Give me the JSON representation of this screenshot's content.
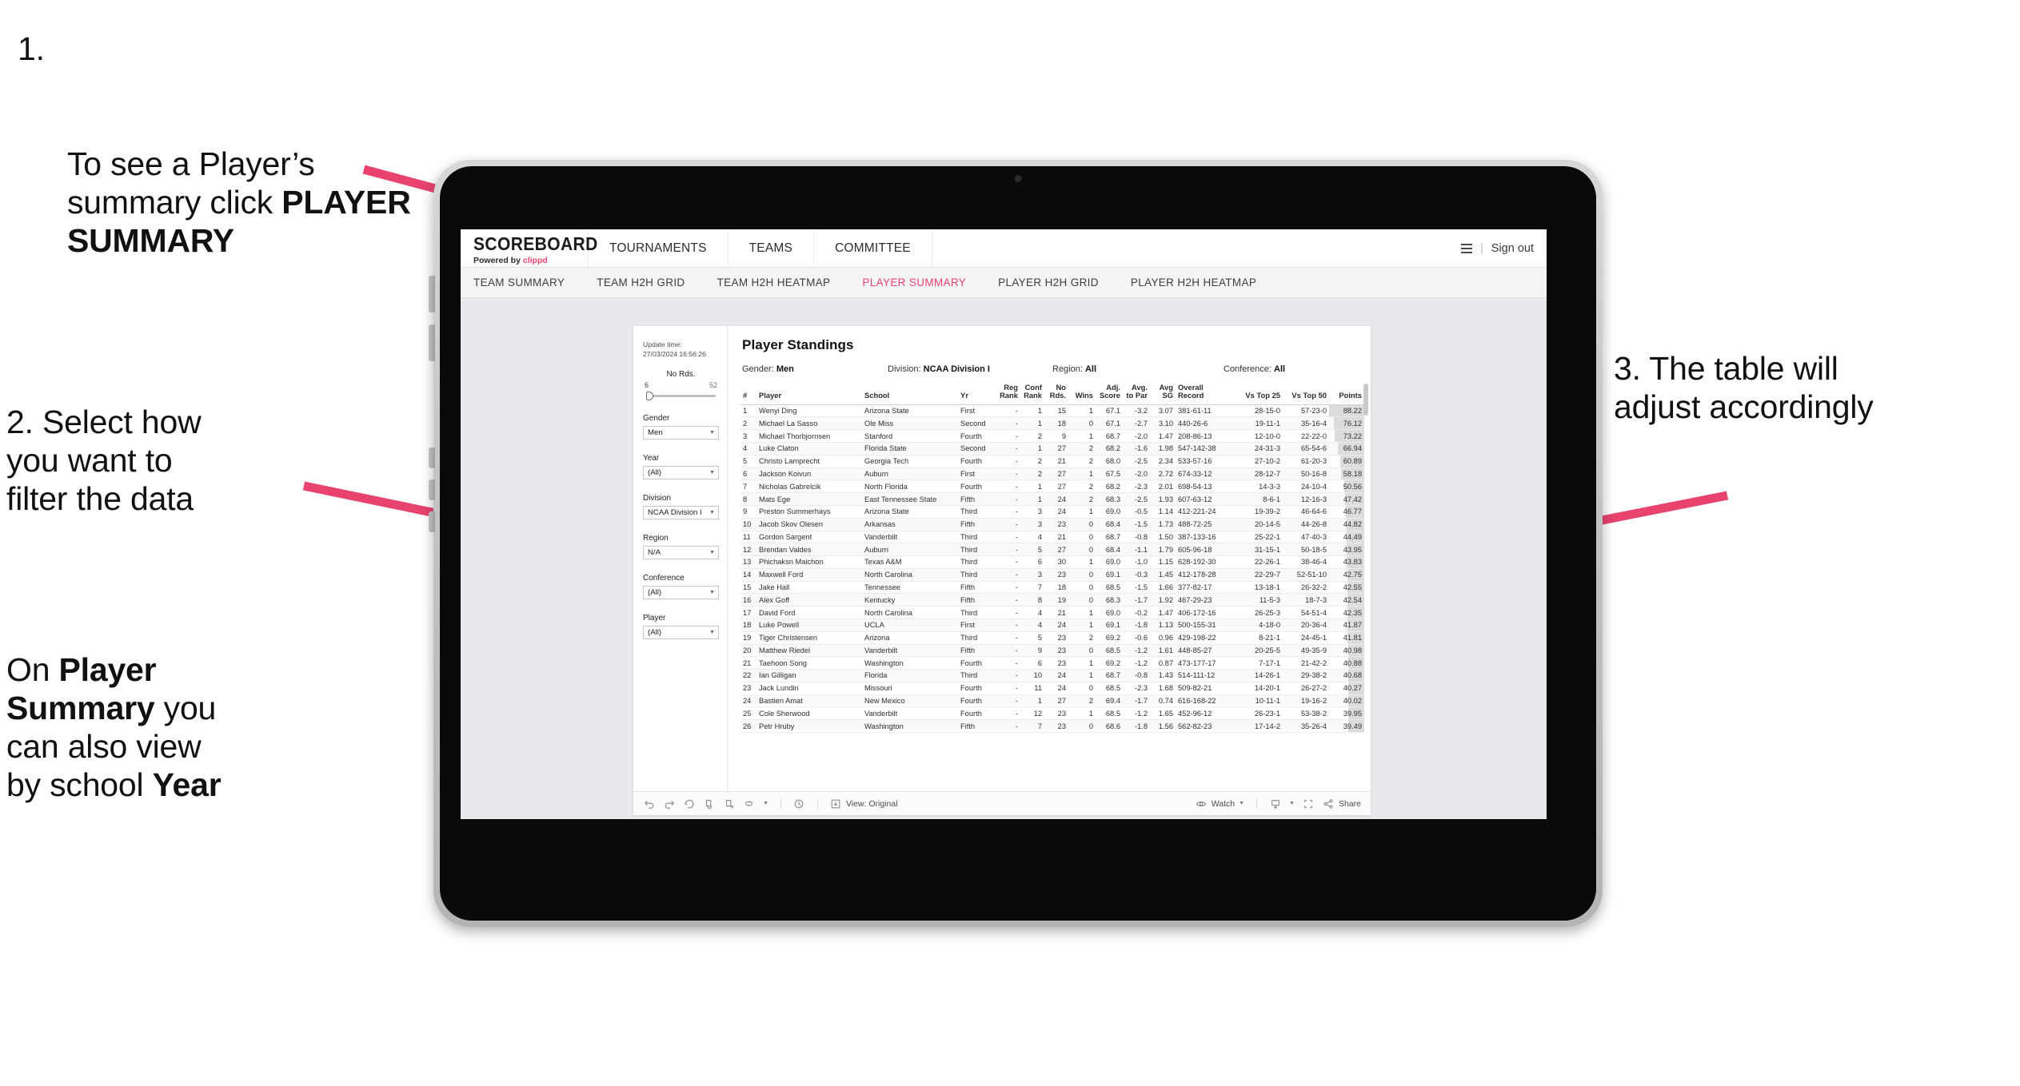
{
  "annotations": {
    "step1": {
      "number": "1.",
      "text_a": "To see a Player’s\nsummary click ",
      "bold_a": "PLAYER\nSUMMARY"
    },
    "step2": {
      "text": "2. Select how\nyou want to\nfilter the data"
    },
    "step3": {
      "pre": "On ",
      "b1": "Player\nSummary",
      "mid": " you\ncan also view\nby school ",
      "b2": "Year"
    },
    "step4": {
      "text": "3. The table will\nadjust accordingly"
    },
    "arrow_color": "#E8436F"
  },
  "app": {
    "brand": {
      "name": "SCOREBOARD",
      "powered_prefix": "Powered by ",
      "powered_brand": "clippd"
    },
    "top_nav": [
      "TOURNAMENTS",
      "TEAMS",
      "COMMITTEE"
    ],
    "top_right": {
      "separator": "|",
      "sign_out": "Sign out"
    },
    "sub_nav": [
      {
        "label": "TEAM SUMMARY",
        "active": false
      },
      {
        "label": "TEAM H2H GRID",
        "active": false
      },
      {
        "label": "TEAM H2H HEATMAP",
        "active": false
      },
      {
        "label": "PLAYER SUMMARY",
        "active": true
      },
      {
        "label": "PLAYER H2H GRID",
        "active": false
      },
      {
        "label": "PLAYER H2H HEATMAP",
        "active": false
      }
    ],
    "active_color": "#E8436F"
  },
  "filters": {
    "update_label": "Update time:",
    "update_value": "27/03/2024 16:56:26",
    "slider": {
      "title": "No Rds.",
      "min": "6",
      "max": "52"
    },
    "selects": [
      {
        "label": "Gender",
        "value": "Men"
      },
      {
        "label": "Year",
        "value": "(All)"
      },
      {
        "label": "Division",
        "value": "NCAA Division I"
      },
      {
        "label": "Region",
        "value": "N/A"
      },
      {
        "label": "Conference",
        "value": "(All)"
      },
      {
        "label": "Player",
        "value": "(All)"
      }
    ]
  },
  "panel": {
    "title": "Player Standings",
    "meta": [
      {
        "label": "Gender:",
        "value": "Men"
      },
      {
        "label": "Division:",
        "value": "NCAA Division I"
      },
      {
        "label": "Region:",
        "value": "All"
      },
      {
        "label": "Conference:",
        "value": "All"
      }
    ]
  },
  "table": {
    "columns": [
      "#",
      "Player",
      "School",
      "Yr",
      "Reg\nRank",
      "Conf\nRank",
      "No\nRds.",
      "Wins",
      "Adj.\nScore",
      "Avg.\nto Par",
      "Avg\nSG",
      "Overall\nRecord",
      "Vs Top 25",
      "Vs Top 50",
      "Points"
    ],
    "rows": [
      [
        "1",
        "Wenyi Ding",
        "Arizona State",
        "First",
        "-",
        "1",
        "15",
        "1",
        "67.1",
        "-3.2",
        "3.07",
        "381-61-11",
        "28-15-0",
        "57-23-0",
        "88.22"
      ],
      [
        "2",
        "Michael La Sasso",
        "Ole Miss",
        "Second",
        "-",
        "1",
        "18",
        "0",
        "67.1",
        "-2.7",
        "3.10",
        "440-26-6",
        "19-11-1",
        "35-16-4",
        "76.12"
      ],
      [
        "3",
        "Michael Thorbjornsen",
        "Stanford",
        "Fourth",
        "-",
        "2",
        "9",
        "1",
        "68.7",
        "-2.0",
        "1.47",
        "208-86-13",
        "12-10-0",
        "22-22-0",
        "73.22"
      ],
      [
        "4",
        "Luke Claton",
        "Florida State",
        "Second",
        "-",
        "1",
        "27",
        "2",
        "68.2",
        "-1.6",
        "1.98",
        "547-142-38",
        "24-31-3",
        "65-54-6",
        "66.94"
      ],
      [
        "5",
        "Christo Lamprecht",
        "Georgia Tech",
        "Fourth",
        "-",
        "2",
        "21",
        "2",
        "68.0",
        "-2.5",
        "2.34",
        "533-57-16",
        "27-10-2",
        "61-20-3",
        "60.89"
      ],
      [
        "6",
        "Jackson Koivun",
        "Auburn",
        "First",
        "-",
        "2",
        "27",
        "1",
        "67.5",
        "-2.0",
        "2.72",
        "674-33-12",
        "28-12-7",
        "50-16-8",
        "58.18"
      ],
      [
        "7",
        "Nicholas Gabrelcik",
        "North Florida",
        "Fourth",
        "-",
        "1",
        "27",
        "2",
        "68.2",
        "-2.3",
        "2.01",
        "698-54-13",
        "14-3-3",
        "24-10-4",
        "50.56"
      ],
      [
        "8",
        "Mats Ege",
        "East Tennessee State",
        "Fifth",
        "-",
        "1",
        "24",
        "2",
        "68.3",
        "-2.5",
        "1.93",
        "607-63-12",
        "8-6-1",
        "12-16-3",
        "47.42"
      ],
      [
        "9",
        "Preston Summerhays",
        "Arizona State",
        "Third",
        "-",
        "3",
        "24",
        "1",
        "69.0",
        "-0.5",
        "1.14",
        "412-221-24",
        "19-39-2",
        "46-64-6",
        "46.77"
      ],
      [
        "10",
        "Jacob Skov Olesen",
        "Arkansas",
        "Fifth",
        "-",
        "3",
        "23",
        "0",
        "68.4",
        "-1.5",
        "1.73",
        "488-72-25",
        "20-14-5",
        "44-26-8",
        "44.82"
      ],
      [
        "11",
        "Gordon Sargent",
        "Vanderbilt",
        "Third",
        "-",
        "4",
        "21",
        "0",
        "68.7",
        "-0.8",
        "1.50",
        "387-133-16",
        "25-22-1",
        "47-40-3",
        "44.49"
      ],
      [
        "12",
        "Brendan Valdes",
        "Auburn",
        "Third",
        "-",
        "5",
        "27",
        "0",
        "68.4",
        "-1.1",
        "1.79",
        "605-96-18",
        "31-15-1",
        "50-18-5",
        "43.95"
      ],
      [
        "13",
        "Phichaksn Maichon",
        "Texas A&M",
        "Third",
        "-",
        "6",
        "30",
        "1",
        "69.0",
        "-1.0",
        "1.15",
        "628-192-30",
        "22-26-1",
        "38-46-4",
        "43.83"
      ],
      [
        "14",
        "Maxwell Ford",
        "North Carolina",
        "Third",
        "-",
        "3",
        "23",
        "0",
        "69.1",
        "-0.3",
        "1.45",
        "412-178-28",
        "22-29-7",
        "52-51-10",
        "42.75"
      ],
      [
        "15",
        "Jake Hall",
        "Tennessee",
        "Fifth",
        "-",
        "7",
        "18",
        "0",
        "68.5",
        "-1.5",
        "1.66",
        "377-82-17",
        "13-18-1",
        "26-32-2",
        "42.55"
      ],
      [
        "16",
        "Alex Goff",
        "Kentucky",
        "Fifth",
        "-",
        "8",
        "19",
        "0",
        "68.3",
        "-1.7",
        "1.92",
        "467-29-23",
        "11-5-3",
        "18-7-3",
        "42.54"
      ],
      [
        "17",
        "David Ford",
        "North Carolina",
        "Third",
        "-",
        "4",
        "21",
        "1",
        "69.0",
        "-0.2",
        "1.47",
        "406-172-16",
        "26-25-3",
        "54-51-4",
        "42.35"
      ],
      [
        "18",
        "Luke Powell",
        "UCLA",
        "First",
        "-",
        "4",
        "24",
        "1",
        "69.1",
        "-1.8",
        "1.13",
        "500-155-31",
        "4-18-0",
        "20-36-4",
        "41.87"
      ],
      [
        "19",
        "Tiger Christensen",
        "Arizona",
        "Third",
        "-",
        "5",
        "23",
        "2",
        "69.2",
        "-0.6",
        "0.96",
        "429-198-22",
        "8-21-1",
        "24-45-1",
        "41.81"
      ],
      [
        "20",
        "Matthew Riedel",
        "Vanderbilt",
        "Fifth",
        "-",
        "9",
        "23",
        "0",
        "68.5",
        "-1.2",
        "1.61",
        "448-85-27",
        "20-25-5",
        "49-35-9",
        "40.98"
      ],
      [
        "21",
        "Taehoon Song",
        "Washington",
        "Fourth",
        "-",
        "6",
        "23",
        "1",
        "69.2",
        "-1.2",
        "0.87",
        "473-177-17",
        "7-17-1",
        "21-42-2",
        "40.88"
      ],
      [
        "22",
        "Ian Gilligan",
        "Florida",
        "Third",
        "-",
        "10",
        "24",
        "1",
        "68.7",
        "-0.8",
        "1.43",
        "514-111-12",
        "14-26-1",
        "29-38-2",
        "40.68"
      ],
      [
        "23",
        "Jack Lundin",
        "Missouri",
        "Fourth",
        "-",
        "11",
        "24",
        "0",
        "68.5",
        "-2.3",
        "1.68",
        "509-82-21",
        "14-20-1",
        "26-27-2",
        "40.27"
      ],
      [
        "24",
        "Bastien Amat",
        "New Mexico",
        "Fourth",
        "-",
        "1",
        "27",
        "2",
        "69.4",
        "-1.7",
        "0.74",
        "616-168-22",
        "10-11-1",
        "19-16-2",
        "40.02"
      ],
      [
        "25",
        "Cole Sherwood",
        "Vanderbilt",
        "Fourth",
        "-",
        "12",
        "23",
        "1",
        "68.5",
        "-1.2",
        "1.65",
        "452-96-12",
        "26-23-1",
        "53-38-2",
        "39.95"
      ],
      [
        "26",
        "Petr Hruby",
        "Washington",
        "Fifth",
        "-",
        "7",
        "23",
        "0",
        "68.6",
        "-1.8",
        "1.56",
        "562-82-23",
        "17-14-2",
        "35-26-4",
        "39.49"
      ]
    ],
    "points_max": 88.22
  },
  "toolbar": {
    "view_label": "View: Original",
    "watch_label": "Watch",
    "share_label": "Share",
    "icons": [
      "undo-icon",
      "redo-icon",
      "revert-icon",
      "refresh-data-icon",
      "pause-icon",
      "stop-icon",
      "history-icon",
      "download-view-icon",
      "watch-eye-icon",
      "export-icon",
      "fullscreen-icon",
      "share-icon"
    ]
  }
}
